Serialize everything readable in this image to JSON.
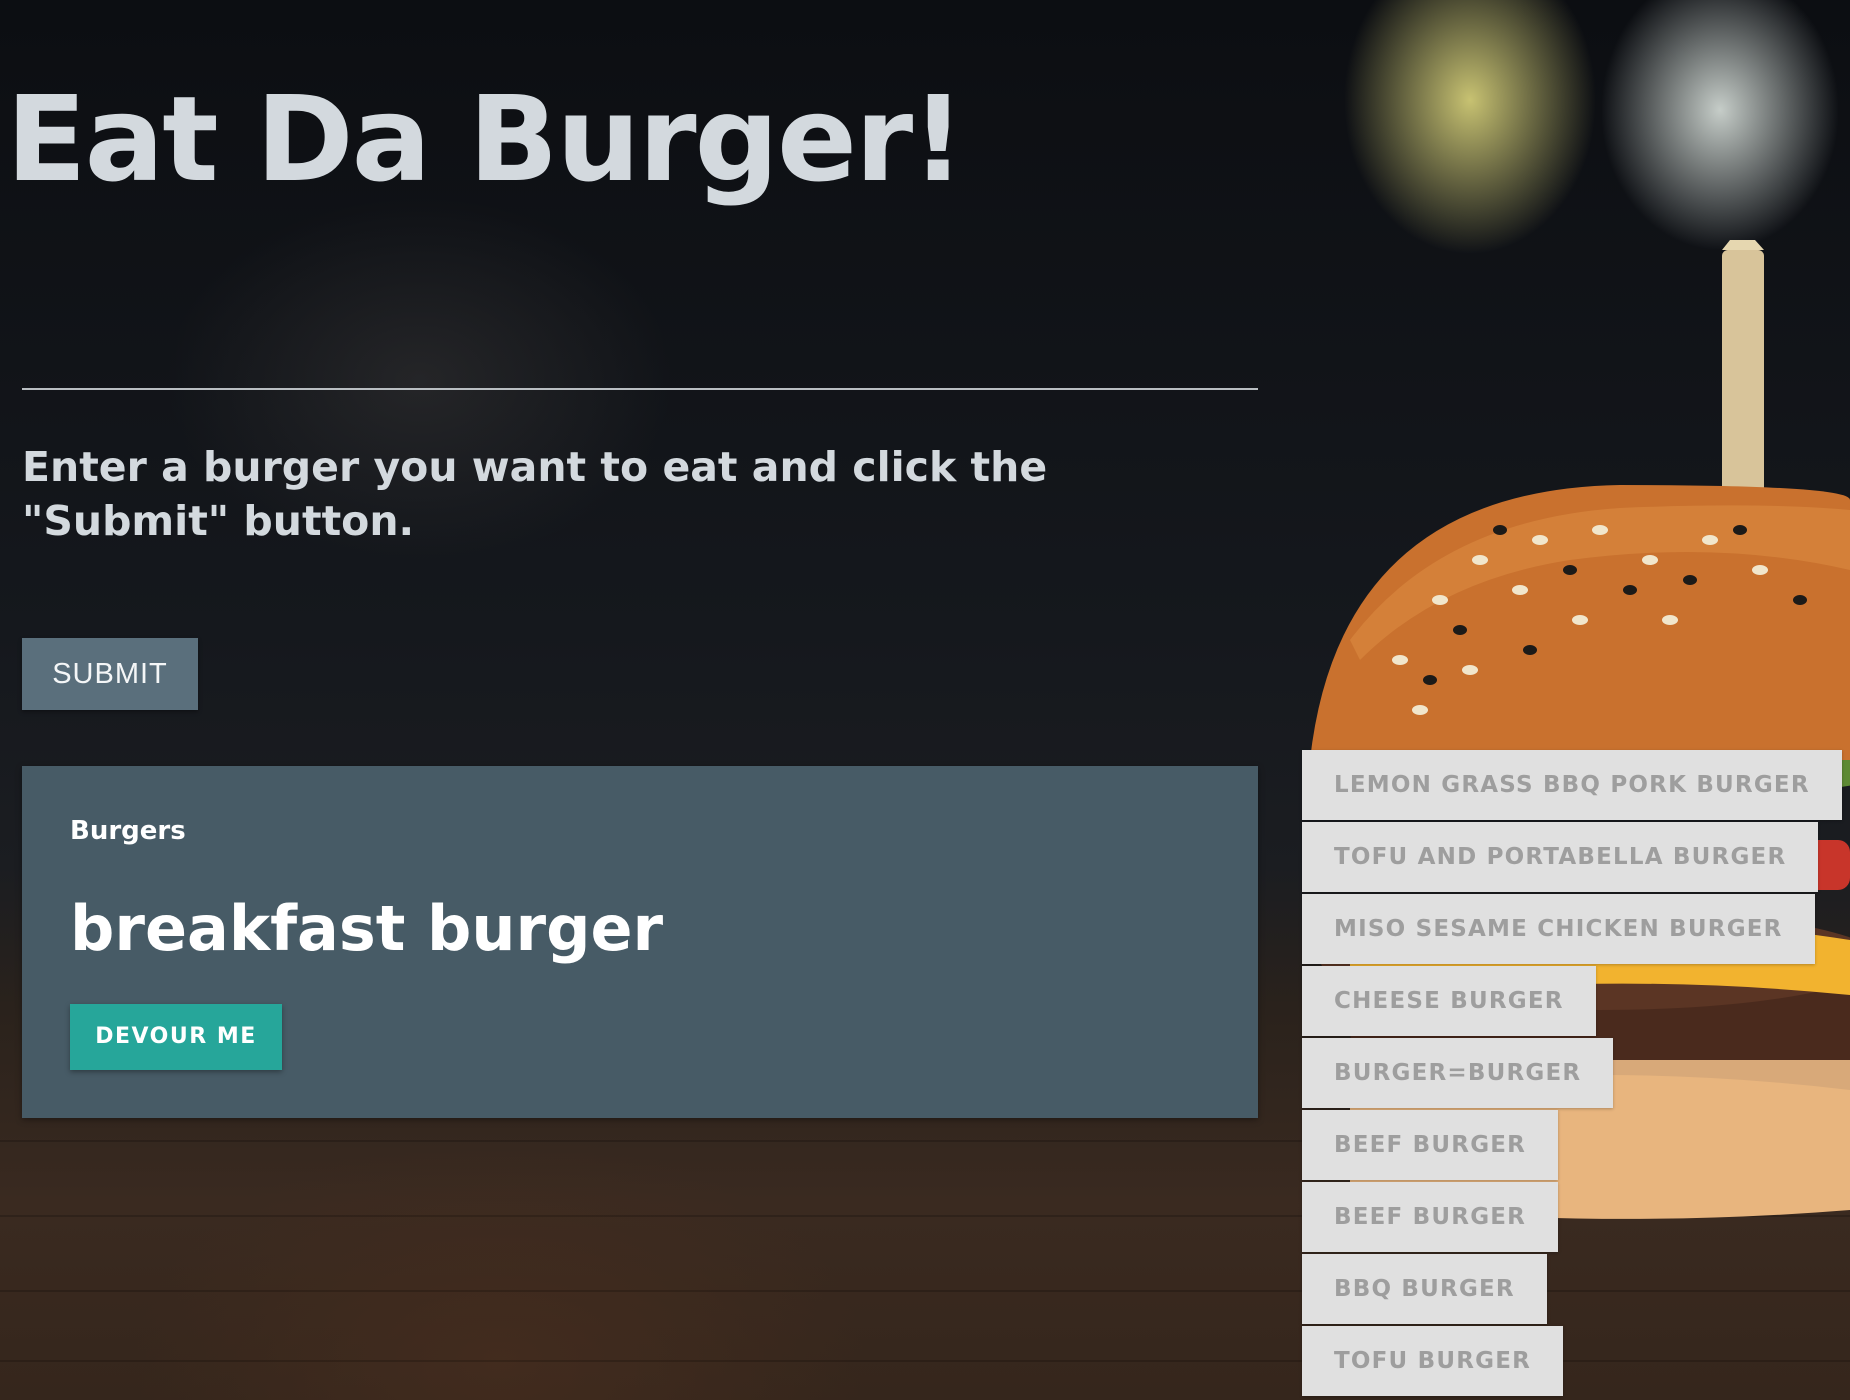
{
  "page": {
    "title": "Eat Da Burger!",
    "instructions": "Enter a burger you want to eat and click the \"Submit\" button.",
    "submit_label": "SUBMIT"
  },
  "panel": {
    "label": "Burgers",
    "burger_name": "breakfast burger",
    "devour_label": "DEVOUR ME"
  },
  "devoured": [
    "LEMON GRASS BBQ PORK BURGER",
    "TOFU AND PORTABELLA BURGER",
    "MISO SESAME CHICKEN BURGER",
    "CHEESE BURGER",
    "BURGER=BURGER",
    "BEEF BURGER",
    "BEEF BURGER",
    "BBQ BURGER",
    "TOFU BURGER"
  ],
  "colors": {
    "title_text": "#d3d9de",
    "submit_button": "#5a6f7c",
    "panel_background": "#475b66",
    "devour_button": "#26a69a",
    "devoured_item_background": "#e0e0e0",
    "devoured_item_text": "#9e9e9e"
  }
}
